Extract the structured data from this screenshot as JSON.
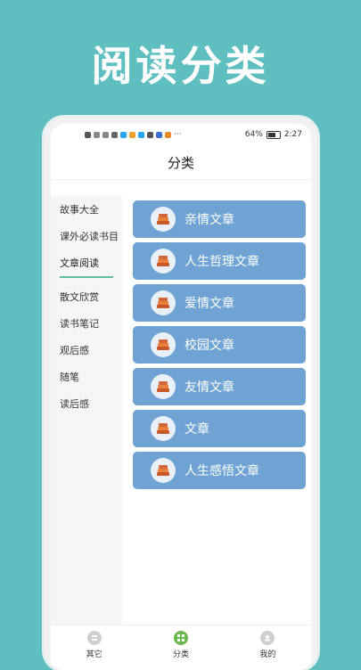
{
  "hero": {
    "title": "阅读分类"
  },
  "status": {
    "battery": "64%",
    "time": "2:27"
  },
  "header": {
    "title": "分类"
  },
  "sidebar": {
    "items": [
      {
        "label": "故事大全"
      },
      {
        "label": "课外必读书目"
      },
      {
        "label": "文章阅读",
        "active": true
      },
      {
        "label": "散文欣赏"
      },
      {
        "label": "读书笔记"
      },
      {
        "label": "观后感"
      },
      {
        "label": "随笔"
      },
      {
        "label": "读后感"
      }
    ]
  },
  "categories": [
    {
      "label": "亲情文章",
      "icon": "stack-books-icon"
    },
    {
      "label": "人生哲理文章",
      "icon": "stack-books-icon"
    },
    {
      "label": "爱情文章",
      "icon": "stack-books-icon"
    },
    {
      "label": "校园文章",
      "icon": "stack-books-icon"
    },
    {
      "label": "友情文章",
      "icon": "stack-books-icon"
    },
    {
      "label": "文章",
      "icon": "stack-books-icon"
    },
    {
      "label": "人生感悟文章",
      "icon": "stack-books-icon"
    }
  ],
  "tabbar": {
    "tabs": [
      {
        "label": "其它",
        "icon": "other-icon"
      },
      {
        "label": "分类",
        "icon": "category-icon",
        "active": true
      },
      {
        "label": "我的",
        "icon": "user-icon"
      }
    ]
  },
  "colors": {
    "background": "#5fbfc0",
    "card": "#6fa3d4",
    "accent": "#6ab94e"
  }
}
